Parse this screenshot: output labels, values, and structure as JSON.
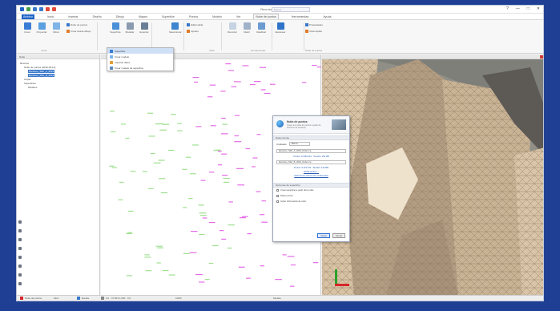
{
  "app": {
    "title": "Recurso ECW for Windows",
    "search_placeholder": "Buscar",
    "window_buttons": [
      "?",
      "—",
      "□",
      "✕"
    ]
  },
  "tabs": [
    {
      "label": "Archivo",
      "active": false,
      "file": true
    },
    {
      "label": "Inicio",
      "active": false
    },
    {
      "label": "Insertar",
      "active": false
    },
    {
      "label": "Diseño",
      "active": false
    },
    {
      "label": "Dibujo",
      "active": false
    },
    {
      "label": "Mapeo",
      "active": false
    },
    {
      "label": "Superficie",
      "active": false
    },
    {
      "label": "Puntos",
      "active": false
    },
    {
      "label": "Modelo",
      "active": false
    },
    {
      "label": "Ver",
      "active": false
    },
    {
      "label": "Nube de puntos",
      "active": true
    },
    {
      "label": "Herramientas",
      "active": false
    },
    {
      "label": "Ayuda",
      "active": false
    }
  ],
  "ribbon": {
    "buttons": [
      {
        "label": "Crear",
        "color": "#3a7bd5"
      },
      {
        "label": "Proyectar",
        "color": "#5aa0e0"
      },
      {
        "label": "Filtrar",
        "color": "#7fb4e6"
      },
      {
        "label": "Superficie",
        "color": "#4b8fd8"
      },
      {
        "label": "Modelar",
        "color": "#8a9bb0"
      },
      {
        "label": "Exportar",
        "color": "#6a7f96"
      },
      {
        "label": "Seleccionar",
        "color": "#3f84cf"
      },
      {
        "label": "Recortar",
        "color": "#c5d3e3"
      },
      {
        "label": "Medir",
        "color": "#9fb2c8"
      },
      {
        "label": "Clasificar",
        "color": "#6b9bd0"
      },
      {
        "label": "Escanear",
        "color": "#2f74c9"
      }
    ],
    "small_items": [
      "Nube de puntos",
      "Crear desde dibujo",
      "Editar tabla",
      "Ajustes",
      "Propiedades",
      "Vista rápida"
    ],
    "groups": [
      "Crear",
      "Editar",
      "Analizar",
      "Vista",
      "Herramientas",
      "Nube de puntos"
    ],
    "dropdown": [
      "Superficie",
      "Crear modelo",
      "Importar datos",
      "Crear modelo de superficie"
    ]
  },
  "left_panel": {
    "header": "Nube",
    "tree": [
      {
        "label": "Recurso",
        "level": 0,
        "selected": false
      },
      {
        "label": "Nube de puntos (2019-05-14)",
        "level": 1,
        "selected": false
      },
      {
        "label": "Escaneo_Sitio_A_2019",
        "level": 2,
        "selected": true
      },
      {
        "label": "Escaneo_Sitio_B_2019",
        "level": 2,
        "selected": true
      },
      {
        "label": "Capas",
        "level": 1,
        "selected": false
      },
      {
        "label": "Superficies",
        "level": 1,
        "selected": false
      },
      {
        "label": "Modelos",
        "level": 2,
        "selected": false
      }
    ]
  },
  "view2d": {
    "header": "Vista en planta"
  },
  "dialog": {
    "title": "Nube de puntos",
    "subtitle": "Crear una nube de puntos a partir de archivos de escaneo",
    "section1": "Datos fuente",
    "unit_label": "Unidades",
    "unit_value": "Metros",
    "file1": "Escaneo_Sitio_A_2019_Nube.rcp",
    "file1_info": "Puntos: 12.845.231 · Tamaño: 184 MB",
    "file2": "Escaneo_Sitio_B_2019_Nube.rcp",
    "file2_info": "Puntos: 9.431.076 · Tamaño: 132 MB",
    "link1": "Añadir archivo…",
    "link2": "Seleccionar sistema de coordenadas",
    "section2": "Opciones de superficie",
    "check1": "Crear superficie a partir de la nube",
    "check2": "Filtrar puntos",
    "check3": "Incluir información de color",
    "ok_label": "Crear",
    "cancel_label": "Cerrar"
  },
  "statusbar": {
    "items": [
      "Nube de puntos",
      "Mod.",
      "Escala",
      "0,0 · 47.823.1,000 · 0,0",
      "100%",
      "Modelo"
    ]
  }
}
